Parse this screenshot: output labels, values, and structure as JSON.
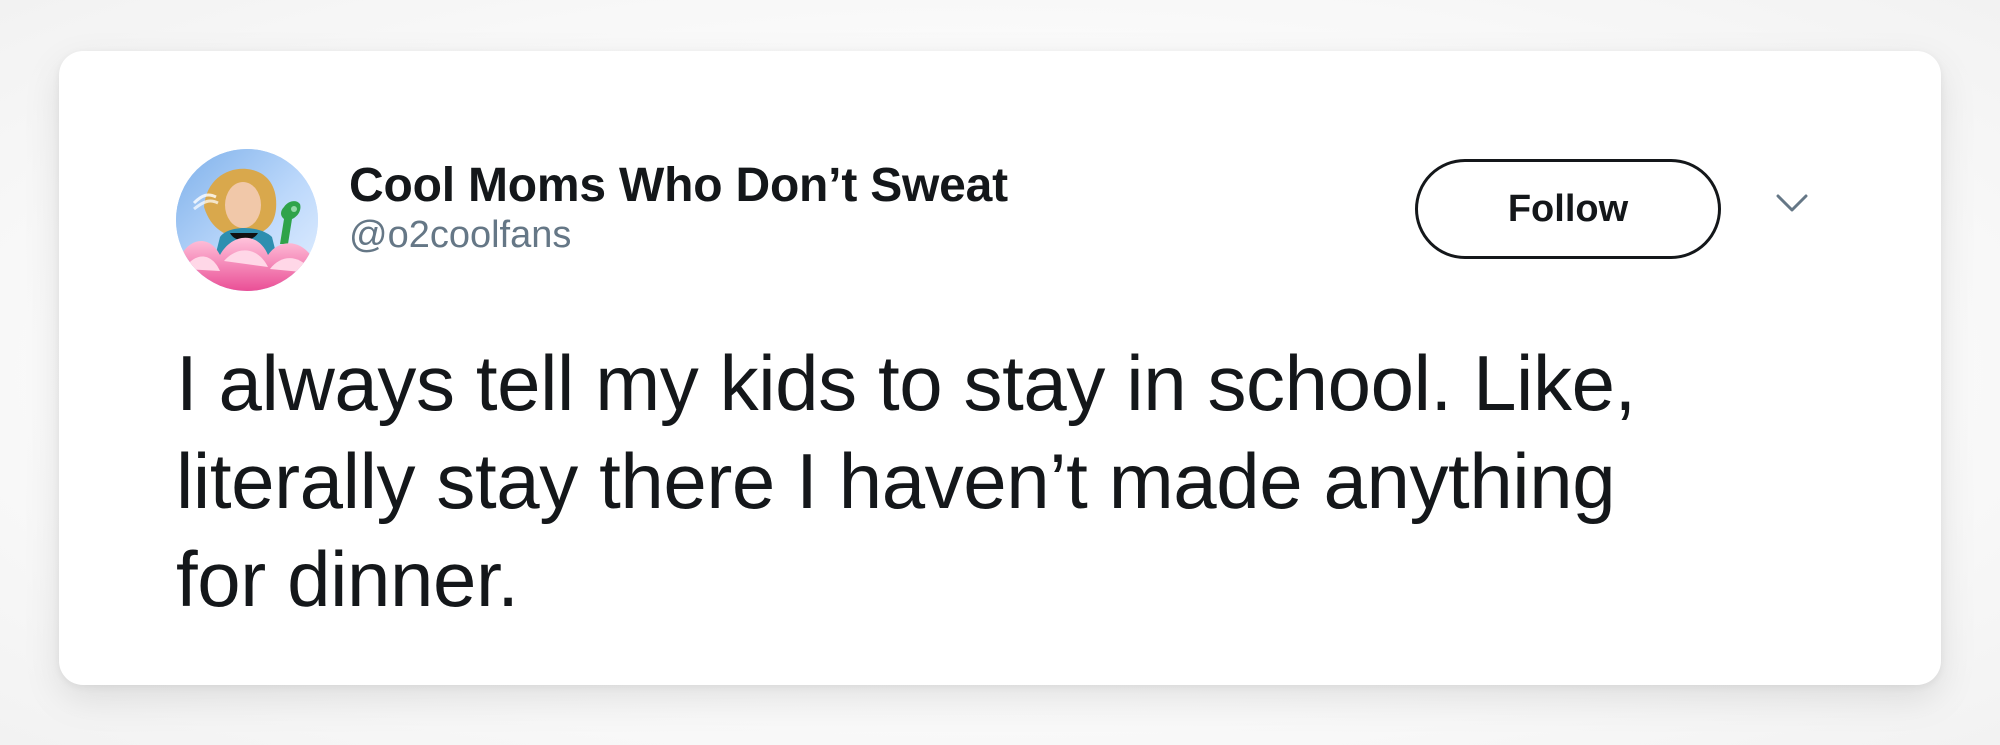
{
  "tweet": {
    "author": {
      "display_name": "Cool Moms Who Don’t Sweat",
      "username": "@o2coolfans",
      "avatar_icon": "woman-with-fan-avatar"
    },
    "actions": {
      "follow_label": "Follow",
      "menu_icon": "chevron-down-icon"
    },
    "body": "I always tell my kids to stay in school. Like,\nliterally stay there I haven’t made anything\nfor dinner."
  },
  "colors": {
    "page_background": "#f7f7f7",
    "card_background": "#ffffff",
    "primary_text": "#14171a",
    "secondary_text": "#657786"
  }
}
